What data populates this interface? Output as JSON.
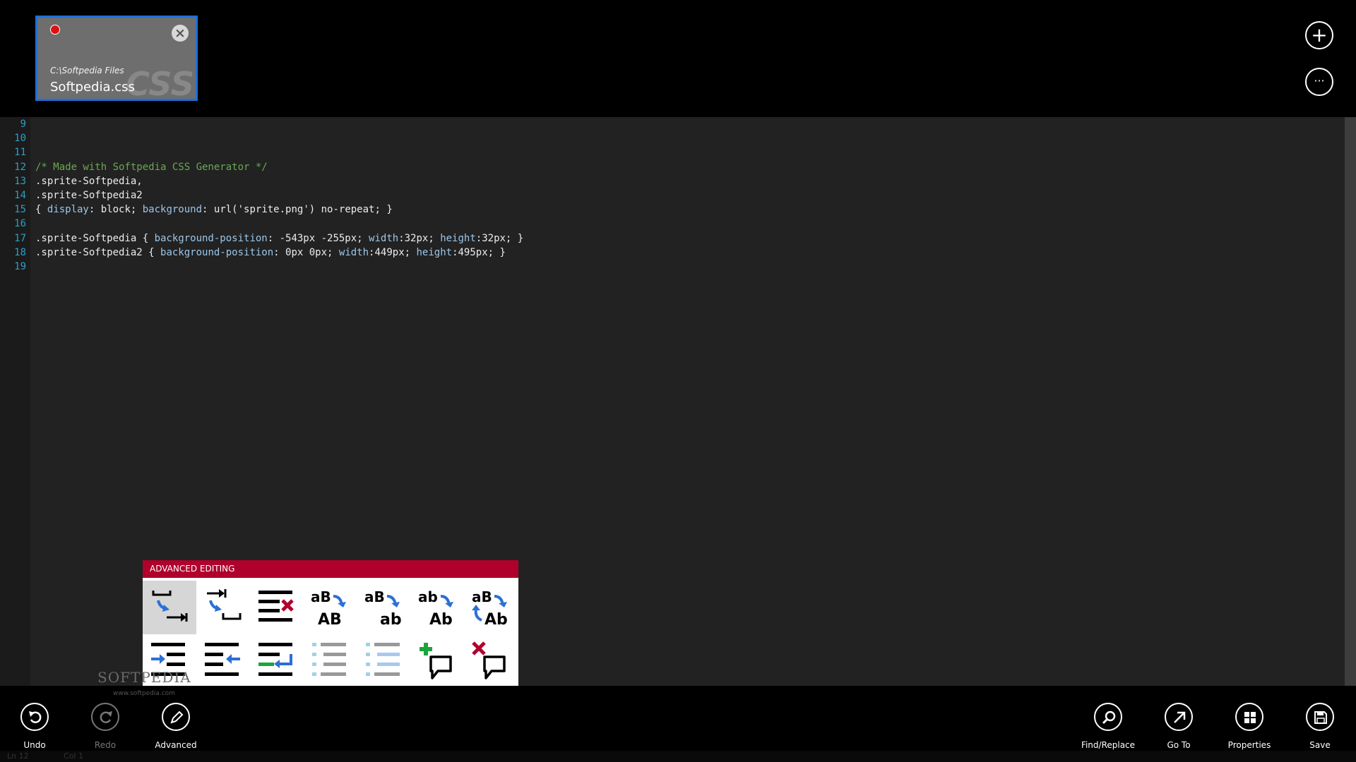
{
  "tab": {
    "path": "C:\\Softpedia Files",
    "filename": "Softpedia.css",
    "type_watermark": "CSS"
  },
  "top_actions": {
    "new": "+",
    "more": "···"
  },
  "editor": {
    "line_numbers": [
      "9",
      "10",
      "11",
      "12",
      "13",
      "14",
      "15",
      "16",
      "17",
      "18",
      "19"
    ],
    "lines": [
      [],
      [],
      [],
      [
        {
          "t": "/* Made with Softpedia CSS Generator */",
          "c": "cm"
        }
      ],
      [
        {
          "t": ".sprite-Softpedia,",
          "c": ""
        }
      ],
      [
        {
          "t": ".sprite-Softpedia2",
          "c": ""
        }
      ],
      [
        {
          "t": "{ ",
          "c": ""
        },
        {
          "t": "display",
          "c": "prop"
        },
        {
          "t": ": block; ",
          "c": ""
        },
        {
          "t": "background",
          "c": "prop"
        },
        {
          "t": ": url('sprite.png') no-repeat; }",
          "c": ""
        }
      ],
      [],
      [
        {
          "t": ".sprite-Softpedia { ",
          "c": ""
        },
        {
          "t": "background-position",
          "c": "prop"
        },
        {
          "t": ": -543px -255px; ",
          "c": ""
        },
        {
          "t": "width",
          "c": "prop"
        },
        {
          "t": ":32px; ",
          "c": ""
        },
        {
          "t": "height",
          "c": "prop"
        },
        {
          "t": ":32px; }",
          "c": ""
        }
      ],
      [
        {
          "t": ".sprite-Softpedia2 { ",
          "c": ""
        },
        {
          "t": "background-position",
          "c": "prop"
        },
        {
          "t": ": 0px 0px; ",
          "c": ""
        },
        {
          "t": "width",
          "c": "prop"
        },
        {
          "t": ":449px; ",
          "c": ""
        },
        {
          "t": "height",
          "c": "prop"
        },
        {
          "t": ":495px; }",
          "c": ""
        }
      ],
      []
    ]
  },
  "advanced_panel": {
    "title": "ADVANCED EDITING",
    "tools": [
      "spaces-to-tabs",
      "tabs-to-spaces",
      "delete-line",
      "uppercase",
      "lowercase",
      "capitalize",
      "swap-case",
      "indent",
      "unindent",
      "rearrange",
      "move-up",
      "move-down",
      "add-comment",
      "remove-comment"
    ],
    "case_labels": {
      "upper": [
        "aB",
        "AB"
      ],
      "lower": [
        "aB",
        "ab"
      ],
      "capitalize": [
        "ab",
        "Ab"
      ],
      "swap": [
        "aB",
        "Ab"
      ]
    }
  },
  "appbar": {
    "undo": "Undo",
    "redo": "Redo",
    "advanced": "Advanced",
    "find_replace": "Find/Replace",
    "goto": "Go To",
    "properties": "Properties",
    "save": "Save"
  },
  "watermark": {
    "brand": "SOFTPEDIA",
    "url": "www.softpedia.com"
  },
  "status": {
    "ln": "Ln 12",
    "col": "Col 1"
  },
  "colors": {
    "accent_red": "#b0002c",
    "tile_border": "#1e6fd9",
    "line_number": "#2e9fc7",
    "comment": "#69a853",
    "property": "#9cc6e8"
  }
}
